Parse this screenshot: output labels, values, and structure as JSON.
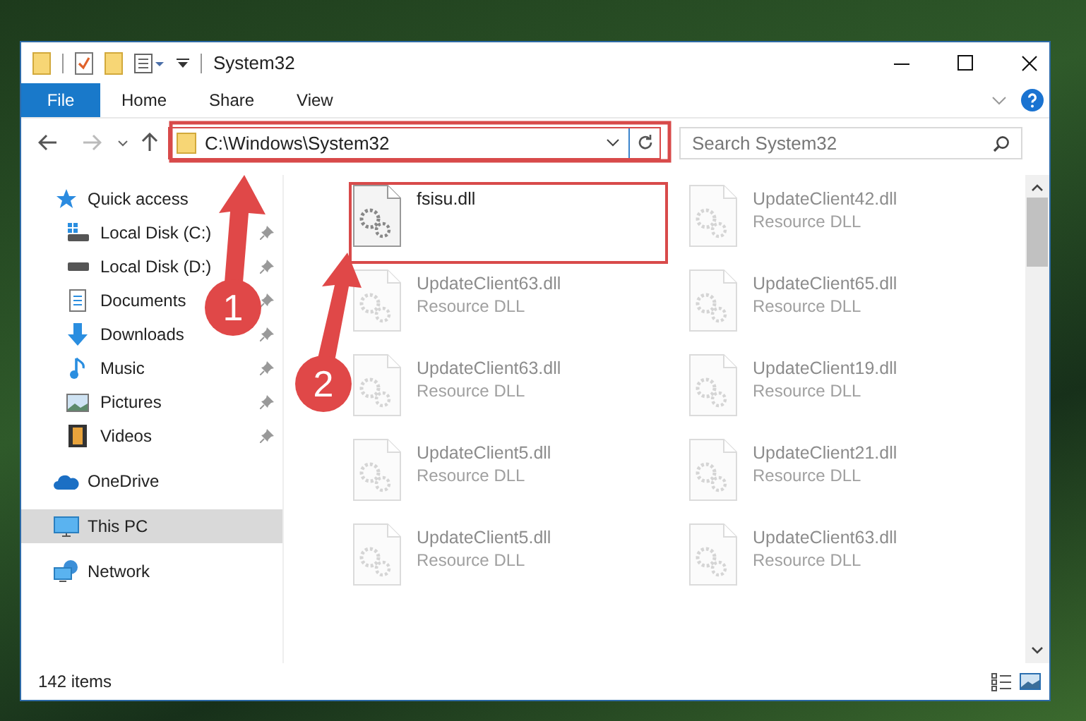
{
  "window": {
    "title": "System32"
  },
  "ribbon_tabs": [
    {
      "label": "File",
      "kind": "file"
    },
    {
      "label": "Home",
      "kind": "tab"
    },
    {
      "label": "Share",
      "kind": "tab"
    },
    {
      "label": "View",
      "kind": "tab"
    }
  ],
  "address_bar": {
    "path": "C:\\Windows\\System32",
    "highlighted": true
  },
  "search": {
    "placeholder": "Search System32"
  },
  "sidebar": {
    "items": [
      {
        "label": "Quick access",
        "kind": "star",
        "selected": false,
        "children": [
          {
            "label": "Local Disk (C:)",
            "kind": "system-drive",
            "pinned": true,
            "selected": false
          },
          {
            "label": "Local Disk (D:)",
            "kind": "drive",
            "pinned": true,
            "selected": false
          },
          {
            "label": "Documents",
            "kind": "documents",
            "pinned": true,
            "selected": false
          },
          {
            "label": "Downloads",
            "kind": "downloads",
            "pinned": true,
            "selected": false
          },
          {
            "label": "Music",
            "kind": "music",
            "pinned": true,
            "selected": false
          },
          {
            "label": "Pictures",
            "kind": "pictures",
            "pinned": true,
            "selected": false
          },
          {
            "label": "Videos",
            "kind": "videos",
            "pinned": true,
            "selected": false
          }
        ]
      },
      {
        "label": "OneDrive",
        "kind": "cloud",
        "selected": false
      },
      {
        "label": "This PC",
        "kind": "computer",
        "selected": true
      },
      {
        "label": "Network",
        "kind": "network",
        "selected": false
      }
    ]
  },
  "files": [
    {
      "name": "fsisu.dll",
      "faded": false,
      "highlighted": true
    },
    {
      "name": "UpdateClient42.dll",
      "type": "Resource DLL",
      "faded": true,
      "highlighted": false
    },
    {
      "name": "UpdateClient63.dll",
      "type": "Resource DLL",
      "faded": true,
      "highlighted": false
    },
    {
      "name": "UpdateClient65.dll",
      "type": "Resource DLL",
      "faded": true,
      "highlighted": false
    },
    {
      "name": "UpdateClient63.dll",
      "type": "Resource DLL",
      "faded": true,
      "highlighted": false
    },
    {
      "name": "UpdateClient19.dll",
      "type": "Resource DLL",
      "faded": true,
      "highlighted": false
    },
    {
      "name": "UpdateClient5.dll",
      "type": "Resource DLL",
      "faded": true,
      "highlighted": false
    },
    {
      "name": "UpdateClient21.dll",
      "type": "Resource DLL",
      "faded": true,
      "highlighted": false
    },
    {
      "name": "UpdateClient5.dll",
      "type": "Resource DLL",
      "faded": true,
      "highlighted": false
    },
    {
      "name": "UpdateClient63.dll",
      "type": "Resource DLL",
      "faded": true,
      "highlighted": false
    }
  ],
  "status_bar": {
    "item_count": "142 items"
  },
  "annotations": [
    {
      "number": "1"
    },
    {
      "number": "2"
    }
  ]
}
